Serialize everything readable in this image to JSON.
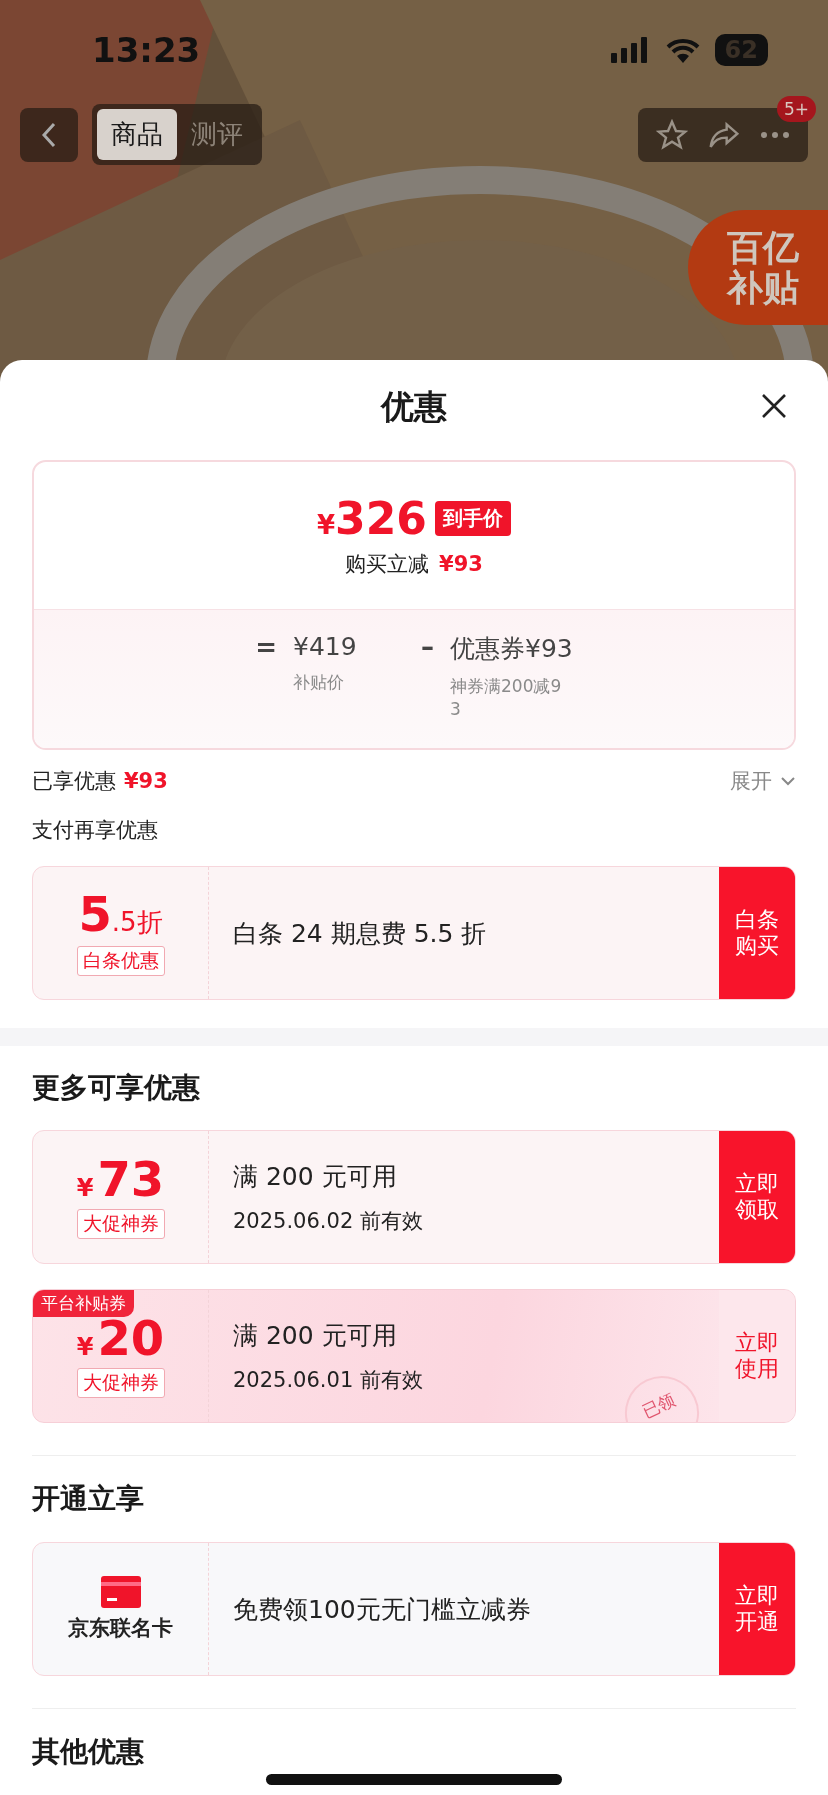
{
  "status_bar": {
    "time": "13:23",
    "battery": "62"
  },
  "nav": {
    "tabs": [
      {
        "label": "商品",
        "selected": true
      },
      {
        "label": "测评",
        "selected": false
      }
    ],
    "badge": "5+"
  },
  "promo_badge": {
    "top": "百亿",
    "bottom": "补贴"
  },
  "sheet": {
    "title": "优惠",
    "price": {
      "currency": "¥",
      "amount": "326",
      "tag": "到手价",
      "saving_label": "购买立减",
      "saving": "¥93",
      "formula": [
        {
          "kind": "operator",
          "text": "="
        },
        {
          "kind": "term",
          "value": "¥419",
          "note": "补贴价"
        },
        {
          "kind": "operator",
          "text": "–"
        },
        {
          "kind": "term",
          "value": "优惠券¥93",
          "note": "神券满200减93"
        }
      ]
    },
    "enjoyed": {
      "label": "已享优惠",
      "amount": "¥93",
      "toggle": "展开"
    },
    "pay": {
      "title": "支付再享优惠",
      "offers": [
        {
          "kind": "discount",
          "value": "5",
          "unit": ".5折",
          "tag": "白条优惠",
          "text": "白条 24 期息费 5.5 折",
          "action": "白条购买"
        }
      ]
    },
    "sections": [
      {
        "title": "更多可享优惠",
        "offers": [
          {
            "kind": "coupon",
            "currency": "¥",
            "amount": "73",
            "tag": "大促神券",
            "condition": "满 200 元可用",
            "expiry": "2025.06.02 前有效",
            "action": "立即领取",
            "claimed": false
          },
          {
            "kind": "coupon",
            "ribbon": "平台补贴券",
            "currency": "¥",
            "amount": "20",
            "tag": "大促神券",
            "condition": "满 200 元可用",
            "expiry": "2025.06.01 前有效",
            "action": "立即使用",
            "claimed": true,
            "stamp": "已领"
          }
        ]
      },
      {
        "title": "开通立享",
        "offers": [
          {
            "kind": "card",
            "name": "京东联名卡",
            "text": "免费领100元无门槛立减券",
            "action": "立即开通"
          }
        ]
      },
      {
        "title": "其他优惠"
      }
    ]
  }
}
